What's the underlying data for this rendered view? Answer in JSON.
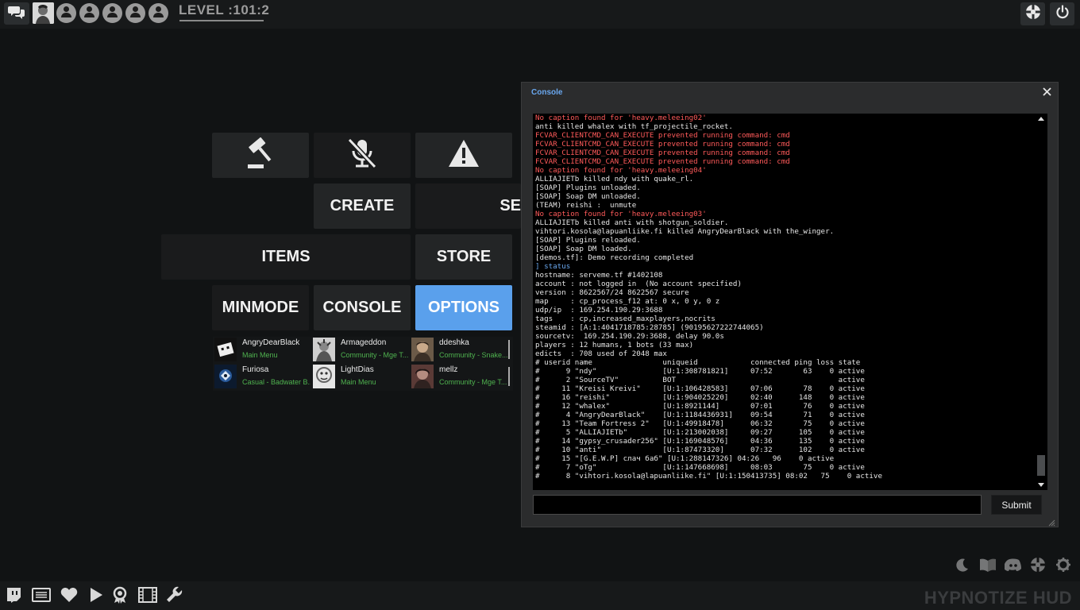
{
  "topbar": {
    "level_text": "LEVEL :101:2",
    "party_slots": 5
  },
  "menu": {
    "create": "CREATE",
    "servers_partial": "SE",
    "items": "ITEMS",
    "store": "STORE",
    "minmode": "MINMODE",
    "console": "CONSOLE",
    "options": "OPTIONS",
    "active_color": "#5aa0ec"
  },
  "friends": [
    {
      "name": "AngryDearBlack",
      "status": "Main Menu"
    },
    {
      "name": "Armageddon",
      "status": "Community - Mge T..."
    },
    {
      "name": "ddeshka",
      "status": "Community - Snake..."
    },
    {
      "name": "Furiosa",
      "status": "Casual - Badwater B..."
    },
    {
      "name": "LightDias",
      "status": "Main Menu"
    },
    {
      "name": "mellz",
      "status": "Community - Mge T..."
    }
  ],
  "console": {
    "title": "Console",
    "input_value": "",
    "submit_label": "Submit",
    "lines": [
      {
        "t": "No caption found for 'heavy.meleeing02'",
        "c": "red"
      },
      {
        "t": "anti killed whalex with tf_projectile_rocket.",
        "c": "white"
      },
      {
        "t": "FCVAR_CLIENTCMD_CAN_EXECUTE prevented running command: cmd",
        "c": "red"
      },
      {
        "t": "FCVAR_CLIENTCMD_CAN_EXECUTE prevented running command: cmd",
        "c": "red"
      },
      {
        "t": "FCVAR_CLIENTCMD_CAN_EXECUTE prevented running command: cmd",
        "c": "red"
      },
      {
        "t": "FCVAR_CLIENTCMD_CAN_EXECUTE prevented running command: cmd",
        "c": "red"
      },
      {
        "t": "No caption found for 'heavy.meleeing04'",
        "c": "red"
      },
      {
        "t": "ALLIAJIETb killed ndy with quake_rl.",
        "c": "white"
      },
      {
        "t": "[SOAP] Plugins unloaded.",
        "c": "white"
      },
      {
        "t": "[SOAP] Soap DM unloaded.",
        "c": "white"
      },
      {
        "t": "(TEAM) reishi :  unmute",
        "c": "white"
      },
      {
        "t": "No caption found for 'heavy.meleeing03'",
        "c": "red"
      },
      {
        "t": "ALLIAJIETb killed anti with shotgun_soldier.",
        "c": "white"
      },
      {
        "t": "vihtori.kosola@lapuanliike.fi killed AngryDearBlack with the_winger.",
        "c": "white"
      },
      {
        "t": "[SOAP] Plugins reloaded.",
        "c": "white"
      },
      {
        "t": "[SOAP] Soap DM loaded.",
        "c": "white"
      },
      {
        "t": "[demos.tf]: Demo recording completed",
        "c": "white"
      },
      {
        "t": "] status",
        "c": "blue"
      },
      {
        "t": "hostname: serveme.tf #1402108",
        "c": "white"
      },
      {
        "t": "account : not logged in  (No account specified)",
        "c": "white"
      },
      {
        "t": "version : 8622567/24 8622567 secure",
        "c": "white"
      },
      {
        "t": "map     : cp_process_f12 at: 0 x, 0 y, 0 z",
        "c": "white"
      },
      {
        "t": "udp/ip  : 169.254.190.29:3688",
        "c": "white"
      },
      {
        "t": "tags    : cp,increased_maxplayers,nocrits",
        "c": "white"
      },
      {
        "t": "steamid : [A:1:4041718785:28785] (90195627222744065)",
        "c": "white"
      },
      {
        "t": "sourcetv:  169.254.190.29:3688, delay 90.0s",
        "c": "white"
      },
      {
        "t": "players : 12 humans, 1 bots (33 max)",
        "c": "white"
      },
      {
        "t": "edicts  : 708 used of 2048 max",
        "c": "white"
      },
      {
        "t": "# userid name                uniqueid            connected ping loss state",
        "c": "white"
      },
      {
        "t": "#      9 \"ndy\"               [U:1:308781821]     07:52       63    0 active",
        "c": "white"
      },
      {
        "t": "#      2 \"SourceTV\"          BOT                                     active",
        "c": "white"
      },
      {
        "t": "#     11 \"Kreisi Kreivi\"     [U:1:106428583]     07:06       78    0 active",
        "c": "white"
      },
      {
        "t": "#     16 \"reishi\"            [U:1:904025220]     02:40      148    0 active",
        "c": "white"
      },
      {
        "t": "#     12 \"whalex\"            [U:1:8921144]       07:01       76    0 active",
        "c": "white"
      },
      {
        "t": "#      4 \"AngryDearBlack\"    [U:1:1184436931]    09:54       71    0 active",
        "c": "white"
      },
      {
        "t": "#     13 \"Team Fortress 2\"   [U:1:49918478]      06:32       75    0 active",
        "c": "white"
      },
      {
        "t": "#      5 \"ALLIAJIETb\"        [U:1:213002038]     09:27      105    0 active",
        "c": "white"
      },
      {
        "t": "#     14 \"gypsy_crusader256\" [U:1:169048576]     04:36      135    0 active",
        "c": "white"
      },
      {
        "t": "#     10 \"anti\"              [U:1:87473320]      07:32      102    0 active",
        "c": "white"
      },
      {
        "t": "#     15 \"[G.E.W.P] слач баб\" [U:1:288147326] 04:26   96    0 active",
        "c": "white"
      },
      {
        "t": "#      7 \"oTg\"               [U:1:147668698]     08:03       75    0 active",
        "c": "white"
      },
      {
        "t": "#      8 \"vihtori.kosola@lapuanliike.fi\" [U:1:150413735] 08:02   75    0 active",
        "c": "white"
      }
    ]
  },
  "branding": {
    "hud_name": "HYPNOTIZE HUD"
  }
}
